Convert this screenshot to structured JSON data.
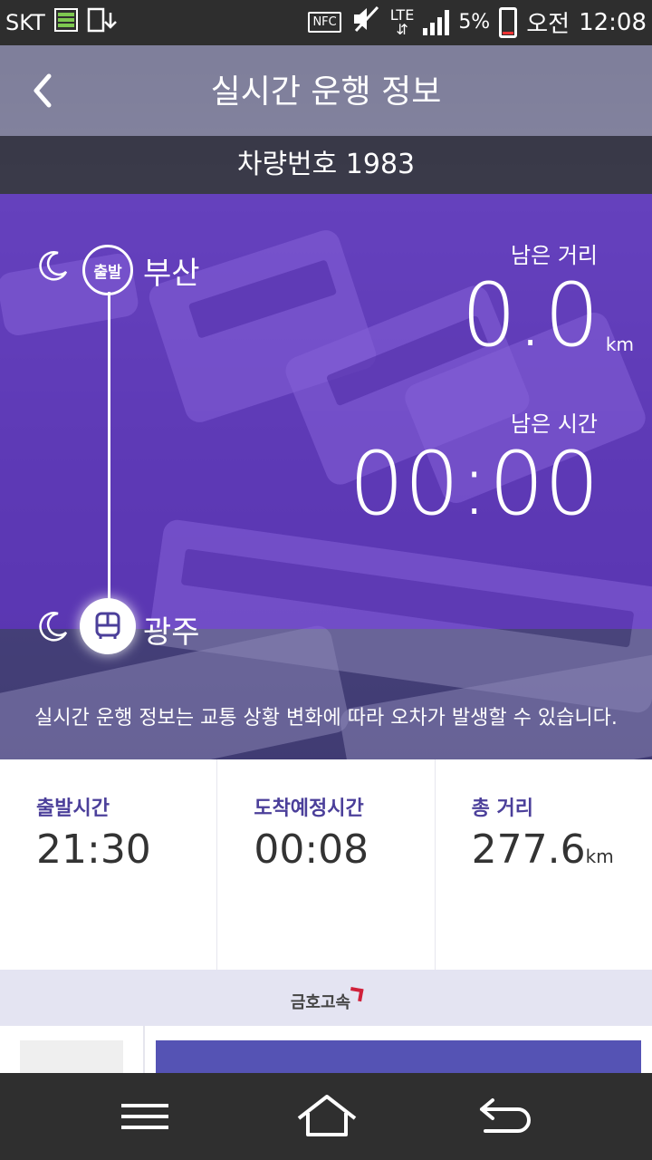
{
  "status_bar": {
    "carrier": "SKT",
    "nfc": "NFC",
    "network": "LTE",
    "battery_text": "5%",
    "ampm": "오전",
    "time": "12:08"
  },
  "header": {
    "title": "실시간 운행 정보",
    "vehicle_number": "차량번호 1983"
  },
  "route": {
    "departure_badge": "출발",
    "departure_city": "부산",
    "arrival_city": "광주"
  },
  "remaining": {
    "distance_label": "남은 거리",
    "distance_value": "0.0",
    "distance_unit": "km",
    "time_label": "남은 시간",
    "time_value": "00:00"
  },
  "notice": "실시간 운행 정보는 교통 상황 변화에 따라 오차가 발생할 수 있습니다.",
  "info": {
    "departure_time_label": "출발시간",
    "departure_time_value": "21:30",
    "eta_label": "도착예정시간",
    "eta_value": "00:08",
    "total_distance_label": "총 거리",
    "total_distance_value": "277.6",
    "total_distance_unit": "km"
  },
  "brand": "금호고속",
  "colors": {
    "overlay_purple": "#6432d2",
    "label_purple": "#4b3f9a",
    "brand_red": "#d0203a",
    "block_purple": "#5553b4"
  }
}
